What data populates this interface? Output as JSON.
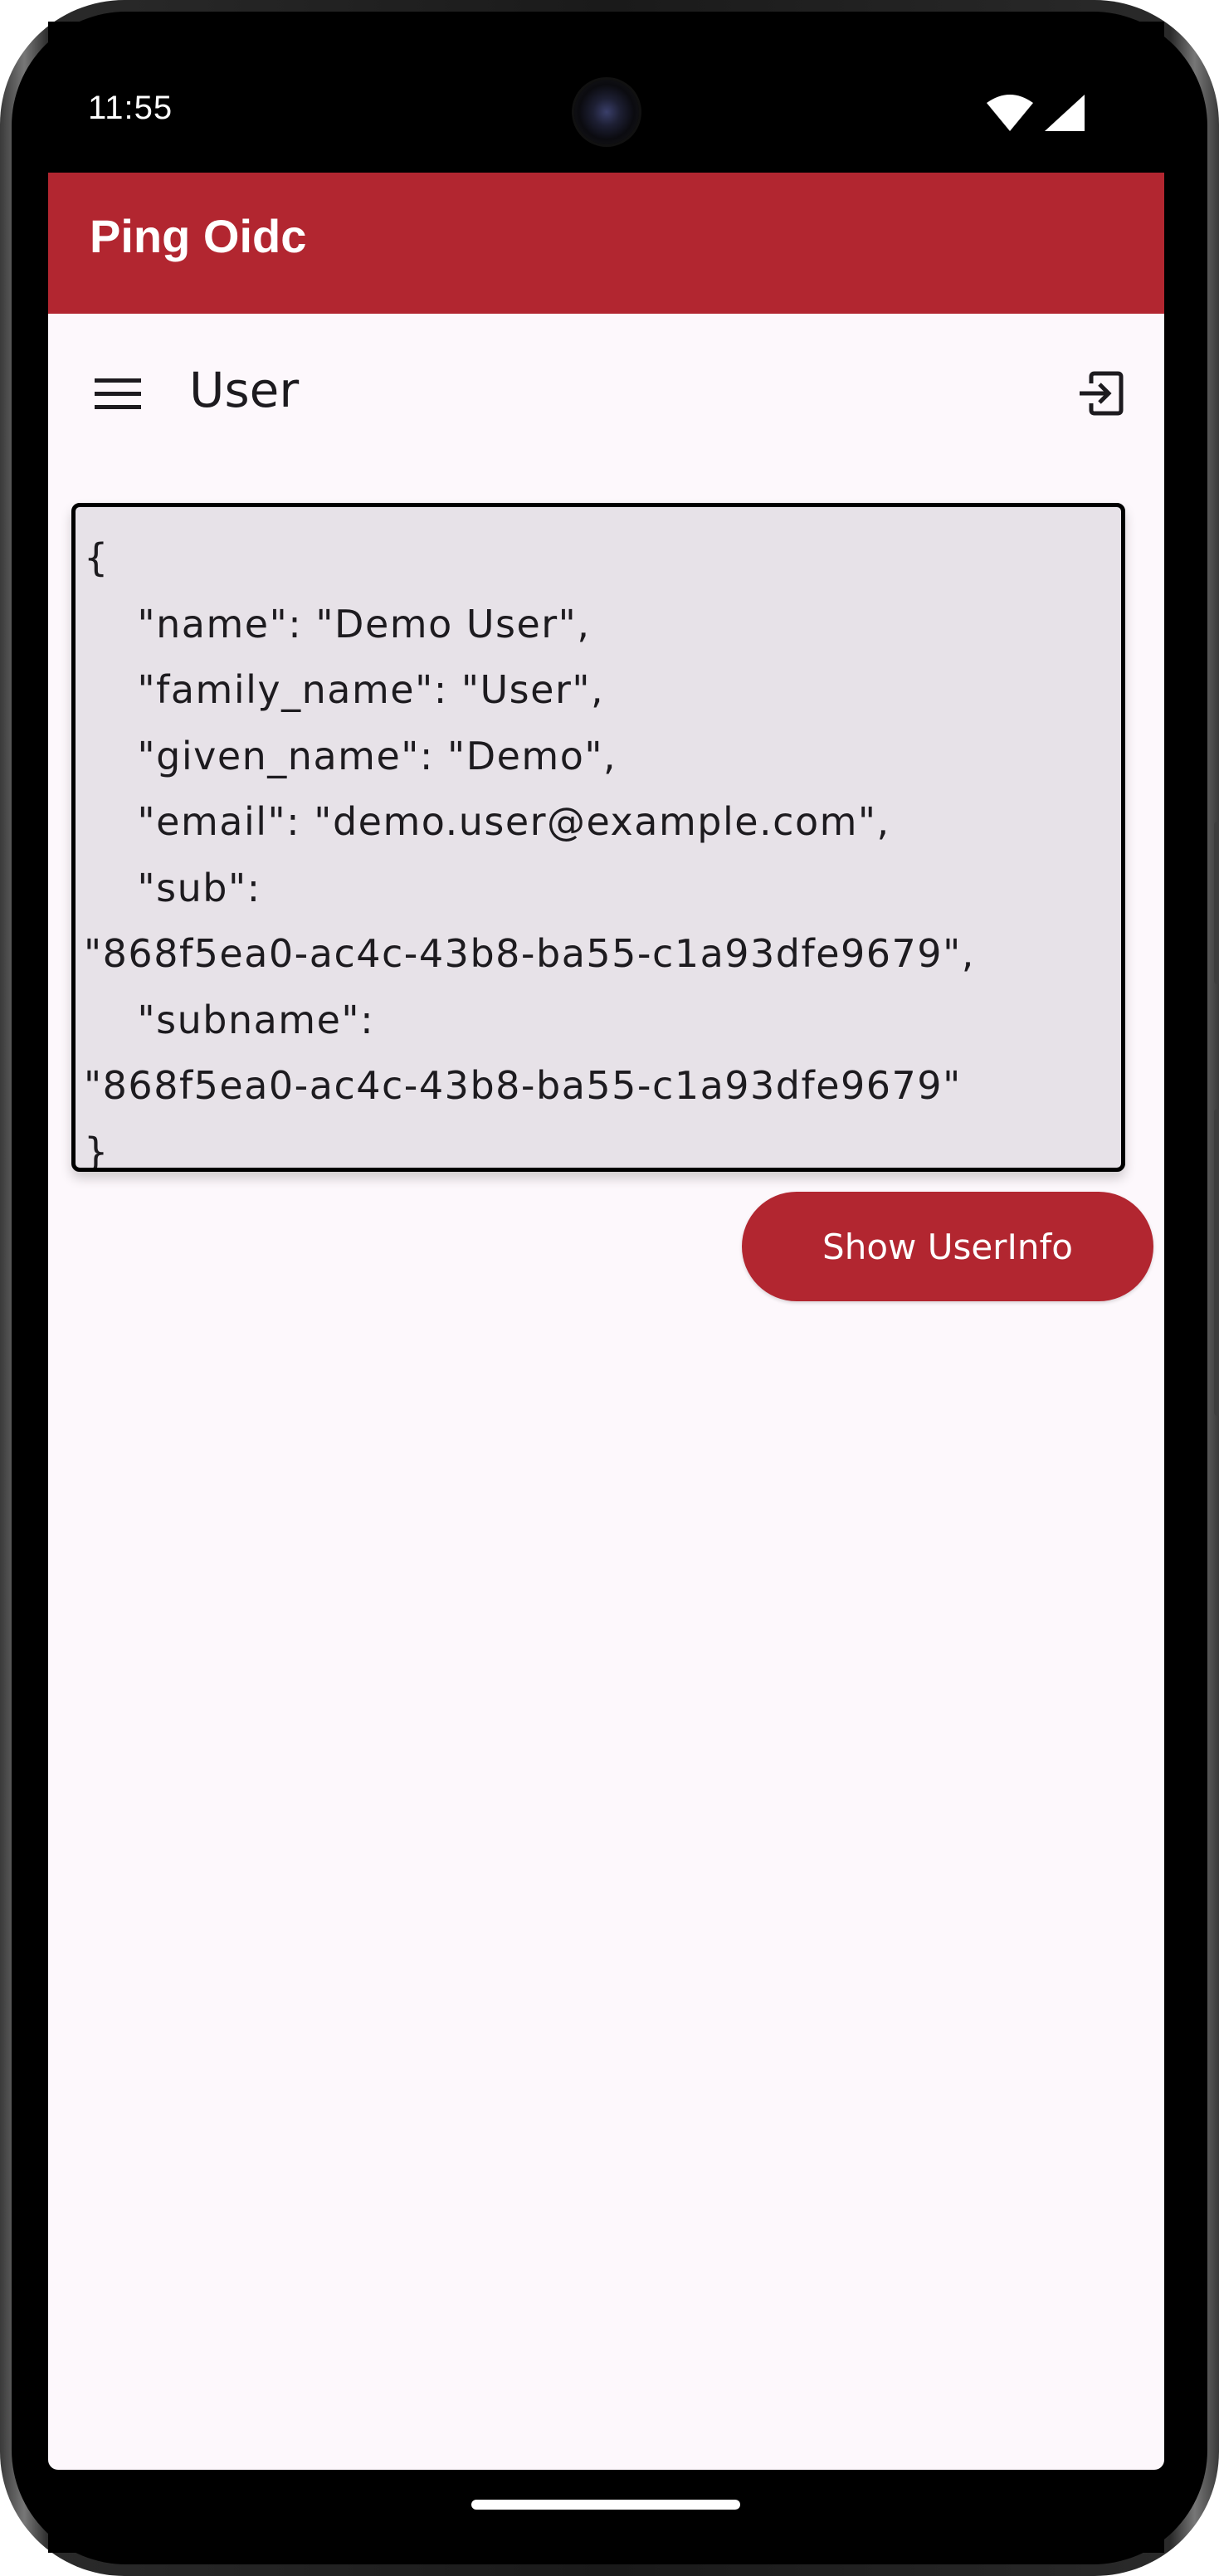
{
  "status_bar": {
    "time": "11:55",
    "wifi_icon": "wifi-icon",
    "signal_icon": "signal-icon"
  },
  "app_bar": {
    "title": "Ping Oidc"
  },
  "top_bar": {
    "menu_icon": "menu-icon",
    "title": "User",
    "logout_icon": "logout-icon"
  },
  "userinfo": {
    "json_text": "{\n    \"name\": \"Demo User\",\n    \"family_name\": \"User\",\n    \"given_name\": \"Demo\",\n    \"email\": \"demo.user@example.com\",\n    \"sub\":\n\"868f5ea0-ac4c-43b8-ba55-c1a93dfe9679\",\n    \"subname\":\n\"868f5ea0-ac4c-43b8-ba55-c1a93dfe9679\"\n}"
  },
  "actions": {
    "show_userinfo_label": "Show UserInfo"
  },
  "colors": {
    "primary": "#b22630",
    "surface": "#fdf8fc",
    "json_background": "#e7e2e8",
    "text": "#1d1b1f"
  }
}
